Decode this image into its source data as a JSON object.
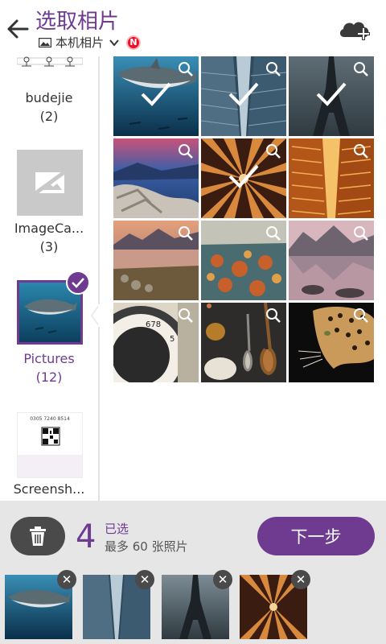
{
  "header": {
    "title": "选取相片",
    "source_label": "本机相片",
    "source_badge": "N"
  },
  "sidebar": {
    "albums": [
      {
        "name": "budejie",
        "count": "(2)"
      },
      {
        "name": "ImageCa...",
        "count": "(3)"
      },
      {
        "name": "Pictures",
        "count": "(12)",
        "selected": true
      },
      {
        "name": "Screensh...",
        "count": ""
      }
    ],
    "screenshot_thumb_text": "0305  7240  8514"
  },
  "grid": {
    "photos": [
      {
        "subject": "shark",
        "selected": true
      },
      {
        "subject": "glass-building",
        "selected": true
      },
      {
        "subject": "eiffel-tower",
        "selected": true
      },
      {
        "subject": "lake-driftwood",
        "selected": false
      },
      {
        "subject": "arch-ceiling",
        "selected": true
      },
      {
        "subject": "orange-towers",
        "selected": false
      },
      {
        "subject": "mountain-lake-sunset",
        "selected": false
      },
      {
        "subject": "autumn-shore",
        "selected": false
      },
      {
        "subject": "mountain-reflection",
        "selected": false
      },
      {
        "subject": "camera-lens",
        "selected": false
      },
      {
        "subject": "spices",
        "selected": false
      },
      {
        "subject": "leopard",
        "selected": false
      }
    ]
  },
  "bottom": {
    "selected_count": "4",
    "selected_label": "已选",
    "max_label": "最多 60 张照片",
    "next_label": "下一步",
    "strip": [
      "shark",
      "glass-building",
      "eiffel-tower",
      "arch-ceiling"
    ]
  },
  "colors": {
    "accent": "#6e3b91",
    "badge": "#e8102a",
    "bottom_bg": "#e6e6e6"
  }
}
